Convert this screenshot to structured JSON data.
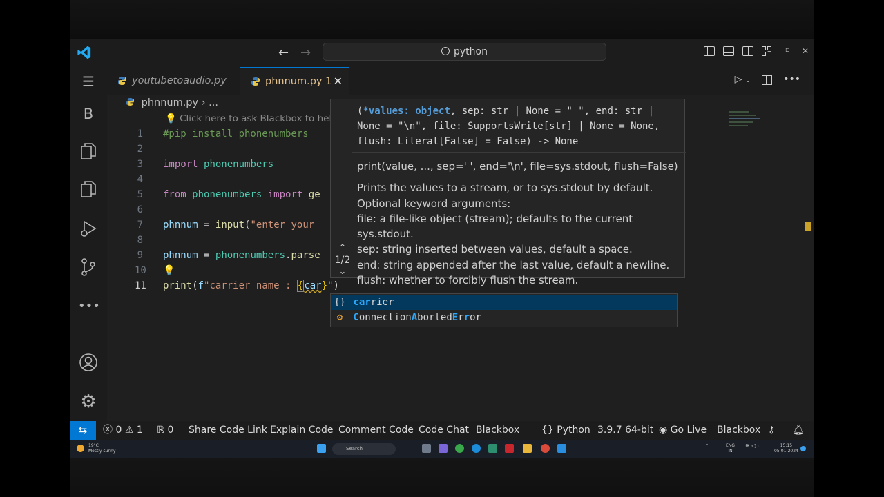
{
  "titlebar": {
    "search_text": "python",
    "back": "←",
    "forward": "→"
  },
  "activity_bar": {
    "items": [
      "menu",
      "blackbox",
      "explorer",
      "copy",
      "run-debug",
      "source-control",
      "more",
      "accounts",
      "manage"
    ],
    "blackbox_label": "B"
  },
  "tabs": [
    {
      "label": "youtubetoaudio.py",
      "active": false
    },
    {
      "label": "phnnum.py",
      "badge": "1",
      "active": true,
      "close": "✕"
    }
  ],
  "breadcrumb": {
    "file": "phnnum.py",
    "sep": "›",
    "rest": "..."
  },
  "hint": "Click here to ask Blackbox to help you",
  "code_lines": [
    {
      "n": "1",
      "t": "#pip install phonenumbers"
    },
    {
      "n": "2",
      "t": ""
    },
    {
      "n": "3",
      "t": "import phonenumbers"
    },
    {
      "n": "4",
      "t": ""
    },
    {
      "n": "5",
      "t": "from phonenumbers import ge"
    },
    {
      "n": "6",
      "t": ""
    },
    {
      "n": "7",
      "t": "phnnum = input(\"enter your"
    },
    {
      "n": "8",
      "t": ""
    },
    {
      "n": "9",
      "t": "phnnum = phonenumbers.parse"
    },
    {
      "n": "10",
      "t": ""
    },
    {
      "n": "11",
      "t": "print(f\"carrier name : {car}\")"
    }
  ],
  "signature": {
    "p1": "(",
    "p2": "*values: object",
    "p3": ", sep: str | None = \" \", end: str | None = \"\\n\", file: SupportsWrite[str] | None = None, flush: Literal[False] = False) -> None",
    "doc_lines": [
      "print(value, ..., sep=' ', end='\\n', file=sys.stdout, flush=False)",
      "",
      "Prints the values to a stream, or to sys.stdout by default.",
      "Optional keyword arguments:",
      "file: a file-like object (stream); defaults to the current sys.stdout.",
      "sep: string inserted between values, default a space.",
      "end: string appended after the last value, default a newline.",
      "flush: whether to forcibly flush the stream."
    ],
    "counter": "1/2"
  },
  "suggestions": [
    {
      "icon": "{}",
      "pre": "",
      "m": "car",
      "post": "rier",
      "selected": true
    },
    {
      "icon": "⚙",
      "text": "ConnectionAbortedError",
      "selected": false
    }
  ],
  "statusbar": {
    "errors": "0",
    "warnings": "1",
    "ports": "0",
    "items": [
      "Share Code Link",
      "Explain Code",
      "Comment Code",
      "Code Chat",
      "Blackbox"
    ],
    "language": "Python",
    "interpreter": "3.9.7 64-bit",
    "golive": "Go Live",
    "blackbox2": "Blackbox"
  },
  "taskbar": {
    "temp": "19°C",
    "weather": "Mostly sunny",
    "search": "Search",
    "lang": "ENG",
    "region": "IN",
    "time": "15:15",
    "date": "05-01-2024"
  }
}
